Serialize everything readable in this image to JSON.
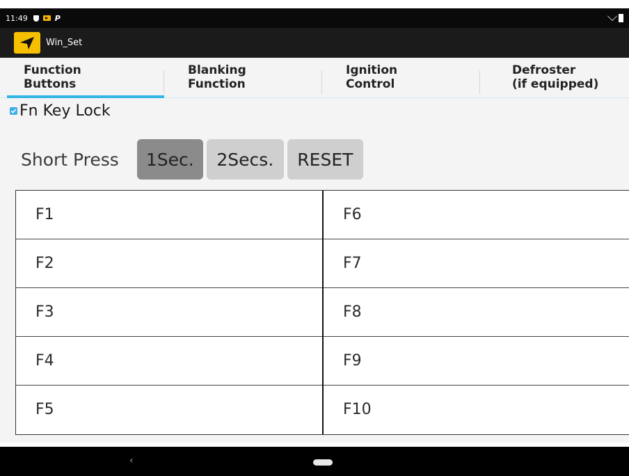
{
  "status_bar": {
    "time": "11:49",
    "icons": [
      "shield-icon",
      "notification-icon",
      "parking-icon",
      "wifi-icon",
      "battery-icon"
    ],
    "p_glyph": "P"
  },
  "app_bar": {
    "title": "Win_Set",
    "logo_icon": "navigation-arrow-icon",
    "logo_color": "#f6c000"
  },
  "tabs": [
    {
      "line1": "Function",
      "line2": "Buttons",
      "selected": true
    },
    {
      "line1": "Blanking",
      "line2": "Function",
      "selected": false
    },
    {
      "line1": "Ignition",
      "line2": "Control",
      "selected": false
    },
    {
      "line1": "Defroster",
      "line2": "(if equipped)",
      "selected": false
    }
  ],
  "fn_key_lock": {
    "label": "Fn Key Lock",
    "checked": true
  },
  "short_press": {
    "label": "Short Press",
    "options": [
      "1Sec.",
      "2Secs.",
      "RESET"
    ],
    "selected": "1Sec."
  },
  "function_keys": {
    "left": [
      "F1",
      "F2",
      "F3",
      "F4",
      "F5"
    ],
    "right": [
      "F6",
      "F7",
      "F8",
      "F9",
      "F10"
    ]
  },
  "nav_bar": {
    "back_glyph": "‹"
  },
  "colors": {
    "accent": "#33b5e5",
    "selected_button": "#8b8b8b",
    "button": "#cfcfcf"
  }
}
